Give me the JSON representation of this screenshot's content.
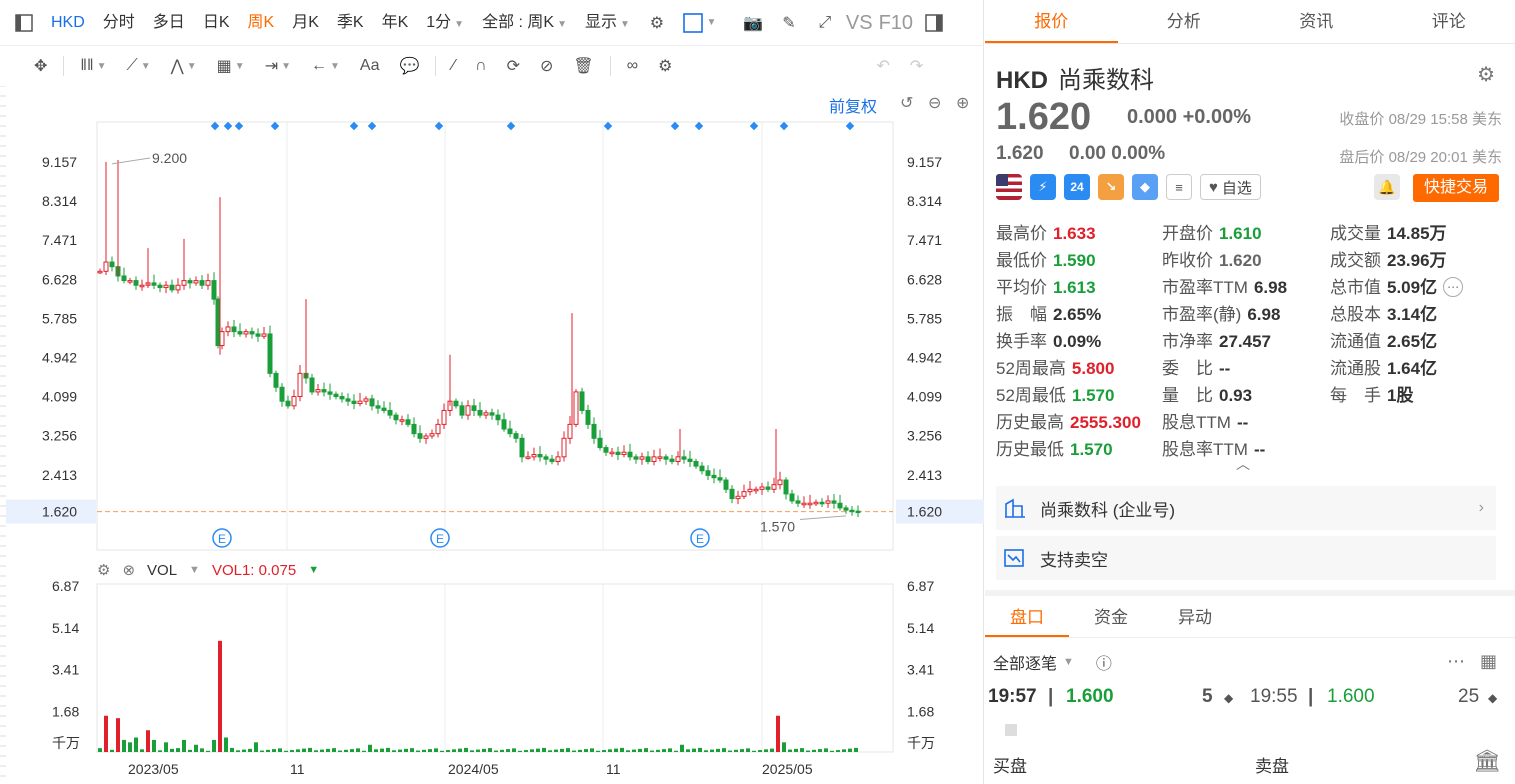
{
  "toolbar": {
    "symbol": "HKD",
    "items": [
      "分时",
      "多日",
      "日K",
      "周K",
      "月K",
      "季K",
      "年K",
      "1分"
    ],
    "active_index": 3,
    "range_label": "全部 : 周K",
    "display_label": "显示",
    "vs_label": "VS",
    "f10_label": "F10"
  },
  "chart": {
    "fuquan_label": "前复权",
    "price_ticks": [
      "9.157",
      "8.314",
      "7.471",
      "6.628",
      "5.785",
      "4.942",
      "4.099",
      "3.256",
      "2.413",
      "1.620"
    ],
    "current_price_label": "1.620",
    "high_annotation": "9.200",
    "low_annotation": "1.570",
    "event_marker": "E",
    "vol_title": "VOL",
    "vol1_label": "VOL1:",
    "vol1_value": "0.075",
    "vol_ticks": [
      "6.87",
      "5.14",
      "3.41",
      "1.68",
      "千万"
    ],
    "x_labels": [
      "2023/05",
      "11",
      "2024/05",
      "11",
      "2025/05"
    ]
  },
  "chart_data": {
    "type": "candlestick",
    "y_ticks": [
      9.157,
      8.314,
      7.471,
      6.628,
      5.785,
      4.942,
      4.099,
      3.256,
      2.413
    ],
    "last_price": 1.62,
    "high": 9.2,
    "low": 1.57,
    "vol_ticks": [
      6.87,
      5.14,
      3.41,
      1.68
    ],
    "vol_unit": "千万",
    "x_labels": [
      "2023/05",
      "11",
      "2024/05",
      "11",
      "2025/05"
    ]
  },
  "quote": {
    "tabs": [
      "报价",
      "分析",
      "资讯",
      "评论"
    ],
    "active_tab": 0,
    "symbol": "HKD",
    "name": "尚乘数科",
    "price": "1.620",
    "change": "0.000 +0.00%",
    "close_time": "收盘价 08/29 15:58 美东",
    "after_price": "1.620",
    "after_change": "0.00 0.00%",
    "after_time": "盘后价 08/29 20:01 美东",
    "watch_label": "自选",
    "trade_label": "快捷交易",
    "badge_24": "24",
    "stats": [
      [
        [
          "最高价",
          "1.633",
          "red"
        ],
        [
          "开盘价",
          "1.610",
          "green"
        ],
        [
          "成交量",
          "14.85万",
          ""
        ]
      ],
      [
        [
          "最低价",
          "1.590",
          "green"
        ],
        [
          "昨收价",
          "1.620",
          "grey"
        ],
        [
          "成交额",
          "23.96万",
          ""
        ]
      ],
      [
        [
          "平均价",
          "1.613",
          "green"
        ],
        [
          "市盈率TTM",
          "6.98",
          ""
        ],
        [
          "总市值",
          "5.09亿",
          ""
        ]
      ],
      [
        [
          "振　幅",
          "2.65%",
          ""
        ],
        [
          "市盈率(静)",
          "6.98",
          ""
        ],
        [
          "总股本",
          "3.14亿",
          ""
        ]
      ],
      [
        [
          "换手率",
          "0.09%",
          ""
        ],
        [
          "市净率",
          "27.457",
          ""
        ],
        [
          "流通值",
          "2.65亿",
          ""
        ]
      ],
      [
        [
          "52周最高",
          "5.800",
          "red"
        ],
        [
          "委　比",
          "--",
          ""
        ],
        [
          "流通股",
          "1.64亿",
          ""
        ]
      ],
      [
        [
          "52周最低",
          "1.570",
          "green"
        ],
        [
          "量　比",
          "0.93",
          ""
        ],
        [
          "每　手",
          "1股",
          ""
        ]
      ],
      [
        [
          "历史最高",
          "2555.300",
          "red"
        ],
        [
          "股息TTM",
          "--",
          ""
        ],
        [
          "",
          ""
        ]
      ],
      [
        [
          "历史最低",
          "1.570",
          "green"
        ],
        [
          "股息率TTM",
          "--",
          ""
        ],
        [
          "",
          ""
        ]
      ]
    ],
    "enterprise_label": "尚乘数科 (企业号)",
    "short_label": "支持卖空",
    "bottom_tabs": [
      "盘口",
      "资金",
      "异动"
    ],
    "all_trades_label": "全部逐笔",
    "tick1": {
      "time": "19:57",
      "price": "1.600",
      "vol": "5"
    },
    "tick2": {
      "time": "19:55",
      "price": "1.600",
      "vol": "25"
    },
    "buy_label": "买盘",
    "sell_label": "卖盘"
  }
}
